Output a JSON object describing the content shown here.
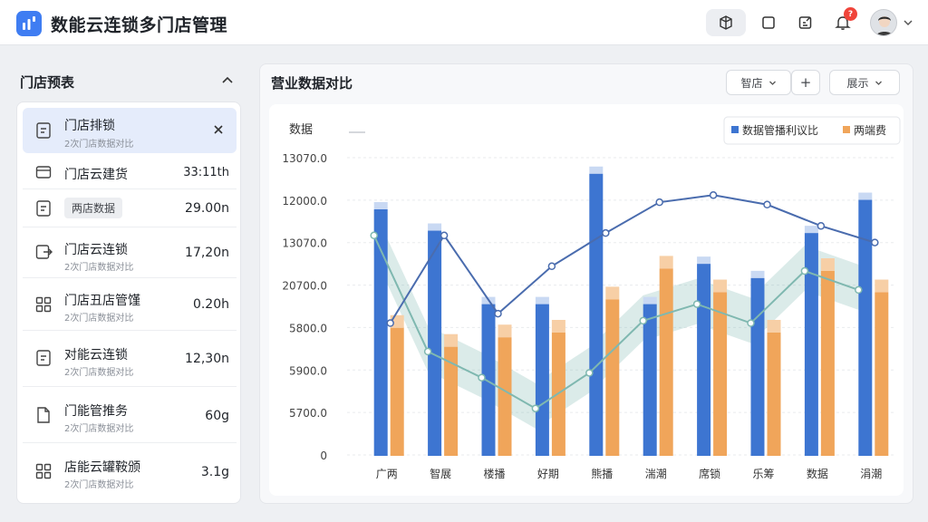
{
  "header": {
    "title": "数能云连锁多门店管理",
    "notification_count": "?"
  },
  "left": {
    "title": "门店预表",
    "stores": [
      {
        "name": "门店排锁",
        "sub": "2次门店数据对比",
        "value": "",
        "selected": true,
        "icon": "document-icon"
      },
      {
        "name": "门店云建货",
        "sub": "",
        "value": "33:11th",
        "icon": "card-icon"
      },
      {
        "name": "",
        "tag": "两店数据",
        "value": "29.00n",
        "icon": "document-icon"
      },
      {
        "name": "门店云连锁",
        "sub": "2次门店数据对比",
        "value": "17,20n",
        "icon": "export-icon"
      },
      {
        "name": "门店丑店管馑",
        "sub": "2次门店数据对比",
        "value": "0.20h",
        "icon": "grid-icon"
      },
      {
        "name": "对能云连锁",
        "sub": "2次门店数据对比",
        "value": "12,30n",
        "icon": "document-icon"
      },
      {
        "name": "门能管推务",
        "sub": "2次门店数据对比",
        "value": "60g",
        "icon": "file-icon"
      },
      {
        "name": "店能云罐鞍颁",
        "sub": "2次门店数据对比",
        "value": "3.1g",
        "icon": "grid-icon"
      }
    ]
  },
  "right": {
    "title": "营业数据对比",
    "select_label": "智店",
    "add_label": "+",
    "display_label": "展示"
  },
  "chart_data": {
    "type": "bar",
    "title": "",
    "ylabel": "数据",
    "y_ticks": [
      "13070.0",
      "12000.0",
      "13070.0",
      "20700.0",
      "5800.0",
      "5900.0",
      "5700.0",
      "0"
    ],
    "categories": [
      "广两",
      "智展",
      "楼播",
      "好期",
      "熊播",
      "湍潮",
      "席锁",
      "乐筹",
      "数据",
      "涓潮"
    ],
    "legend": [
      "数据管播利议比",
      "两端费"
    ],
    "colors": {
      "blue": "#3d75d1",
      "orange": "#f0a55a",
      "line": "#4a6cae",
      "teal": "#7fb8b0"
    },
    "series": [
      {
        "name": "数据管播利议比",
        "values": [
          10400,
          9500,
          6400,
          6400,
          11900,
          6400,
          8100,
          7500,
          9400,
          10800
        ]
      },
      {
        "name": "两端费",
        "values": [
          5400,
          4600,
          5000,
          5200,
          6600,
          7900,
          6900,
          5200,
          7800,
          6900
        ]
      }
    ],
    "line_values": [
      5600,
      9300,
      6000,
      8000,
      9400,
      10700,
      11000,
      10600,
      9700,
      9000
    ],
    "teal_values": [
      9300,
      4400,
      3300,
      2000,
      3500,
      5700,
      6400,
      5600,
      7800,
      7000
    ]
  }
}
